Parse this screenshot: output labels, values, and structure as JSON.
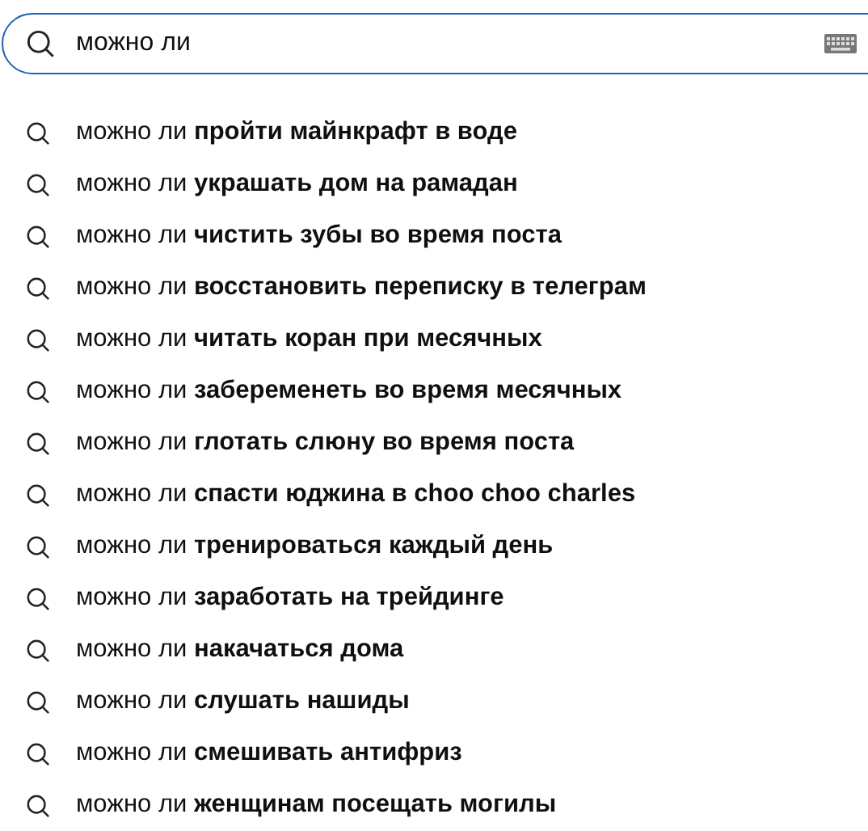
{
  "search": {
    "value": "можно ли "
  },
  "suggestions": [
    {
      "text": "можно ли **пройти майнкрафт в воде**"
    },
    {
      "text": "можно ли **украшать дом на рамадан**"
    },
    {
      "text": "можно ли **чистить зубы во время поста**"
    },
    {
      "text": "можно ли **восстановить переписку в телеграм**"
    },
    {
      "text": "можно ли **читать коран при месячных**"
    },
    {
      "text": "можно ли **забеременеть во время месячных**"
    },
    {
      "text": "можно ли **глотать слюну во время поста**"
    },
    {
      "text": "можно ли **спасти юджина в choo choo charles**"
    },
    {
      "text": "можно ли **тренироваться каждый день**"
    },
    {
      "text": "можно ли **заработать на трейдинге**"
    },
    {
      "text": "можно ли **накачаться дома**"
    },
    {
      "text": "можно ли **слушать нашиды**"
    },
    {
      "text": "можно ли **смешивать антифриз**"
    },
    {
      "text": "можно ли **женщинам посещать могилы**"
    }
  ]
}
